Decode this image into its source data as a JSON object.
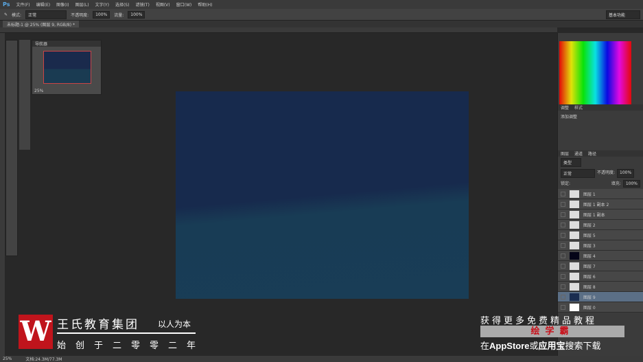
{
  "menu": {
    "logo": "Ps",
    "items": [
      "文件(F)",
      "编辑(E)",
      "图像(I)",
      "图层(L)",
      "文字(Y)",
      "选择(S)",
      "滤镜(T)",
      "视图(V)",
      "窗口(W)",
      "帮助(H)"
    ]
  },
  "options": {
    "mode_label": "模式:",
    "mode": "正常",
    "opacity_label": "不透明度:",
    "opacity": "100%",
    "flow_label": "流量:",
    "flow": "100%",
    "workspace": "基本功能"
  },
  "document_tab": "未标题-1 @ 25% (图层 9, RGB/8) *",
  "navigator": {
    "title": "导航器",
    "zoom": "25%"
  },
  "adjustments": {
    "tabs": [
      "调整",
      "样式"
    ],
    "title": "添加调整"
  },
  "layers_panel": {
    "tabs": [
      "图层",
      "通道",
      "路径"
    ],
    "filter": "类型",
    "blend": "正常",
    "opacity_label": "不透明度:",
    "opacity": "100%",
    "lock_label": "锁定:",
    "fill_label": "填充:",
    "fill": "100%",
    "layers": [
      {
        "name": "图层 1"
      },
      {
        "name": "图层 1 副本 2"
      },
      {
        "name": "图层 1 副本"
      },
      {
        "name": "图层 2"
      },
      {
        "name": "图层 5"
      },
      {
        "name": "图层 3"
      },
      {
        "name": "图层 4",
        "thumb": "#050518"
      },
      {
        "name": "图层 7"
      },
      {
        "name": "图层 6"
      },
      {
        "name": "图层 8"
      },
      {
        "name": "图层 9",
        "thumb": "#1a2d50",
        "selected": true
      },
      {
        "name": "图层 0",
        "thumb": "#ffffff"
      }
    ]
  },
  "status": {
    "zoom": "25%",
    "doc": "文档:24.3M/77.3M"
  },
  "overlay": {
    "brand_logo": "W",
    "brand_name": "王氏教育集团",
    "slogan": "以人为本",
    "founded": "始创于二零零二年",
    "ad_line1": "获得更多免费精品教程",
    "ad_app": "绘学霸",
    "ad_line3_a": "在",
    "ad_line3_b": "AppStore",
    "ad_line3_c": "或",
    "ad_line3_d": "应用宝",
    "ad_line3_e": "搜索下载"
  },
  "colors": {
    "canvas_top": "#172a4d",
    "canvas_bottom": "#193d56",
    "brand_red": "#c0141c"
  }
}
